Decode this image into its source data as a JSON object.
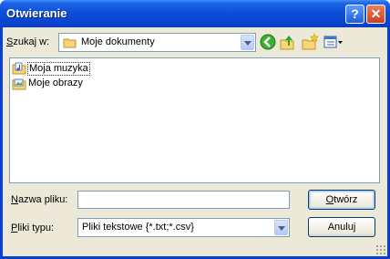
{
  "window": {
    "title": "Otwieranie"
  },
  "titlebar": {
    "help_glyph": "?",
    "close_glyph": "✕"
  },
  "lookin": {
    "label_u": "S",
    "label_rest": "zukaj w:",
    "value": "Moje dokumenty",
    "icon": "folder-icon"
  },
  "toolbar": {
    "icons": [
      "back-icon",
      "up-folder-icon",
      "new-folder-icon",
      "views-menu-icon"
    ]
  },
  "files": [
    {
      "name": "Moja muzyka",
      "icon": "music-folder-icon",
      "selected": true
    },
    {
      "name": "Moje obrazy",
      "icon": "pictures-folder-icon",
      "selected": false
    }
  ],
  "filename": {
    "label_u": "N",
    "label_rest": "azwa pliku:",
    "value": ""
  },
  "filetype": {
    "label_u": "P",
    "label_rest": "liki typu:",
    "value": "Pliki tekstowe {*.txt;*.csv}"
  },
  "buttons": {
    "open_u": "O",
    "open_rest": "twórz",
    "cancel": "Anuluj"
  },
  "colors": {
    "title_bar": "#0a48d3",
    "dialog_bg": "#ece9d8",
    "field_border": "#7f9db9"
  }
}
